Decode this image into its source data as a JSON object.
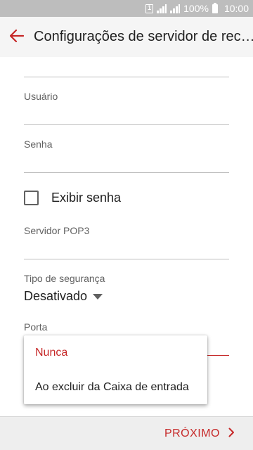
{
  "status_bar": {
    "sim_label": "1",
    "battery": "100%",
    "time": "10:00"
  },
  "header": {
    "title": "Configurações de servidor de rec…"
  },
  "form": {
    "username_label": "Usuário",
    "username_value": "",
    "password_label": "Senha",
    "password_value": "",
    "show_password_label": "Exibir senha",
    "show_password_checked": false,
    "pop3_label": "Servidor POP3",
    "pop3_value": "",
    "security_label": "Tipo de segurança",
    "security_value": "Desativado",
    "port_label": "Porta"
  },
  "dropdown": {
    "items": [
      {
        "label": "Nunca",
        "selected": true
      },
      {
        "label": "Ao excluir da Caixa de entrada",
        "selected": false
      }
    ]
  },
  "footer": {
    "next_label": "PRÓXIMO"
  },
  "colors": {
    "accent": "#c62828",
    "status_bar": "#bdbdbd"
  },
  "icons": {
    "back": "arrow-left-icon",
    "next": "chevron-right-icon",
    "dropdown": "caret-down-icon"
  }
}
